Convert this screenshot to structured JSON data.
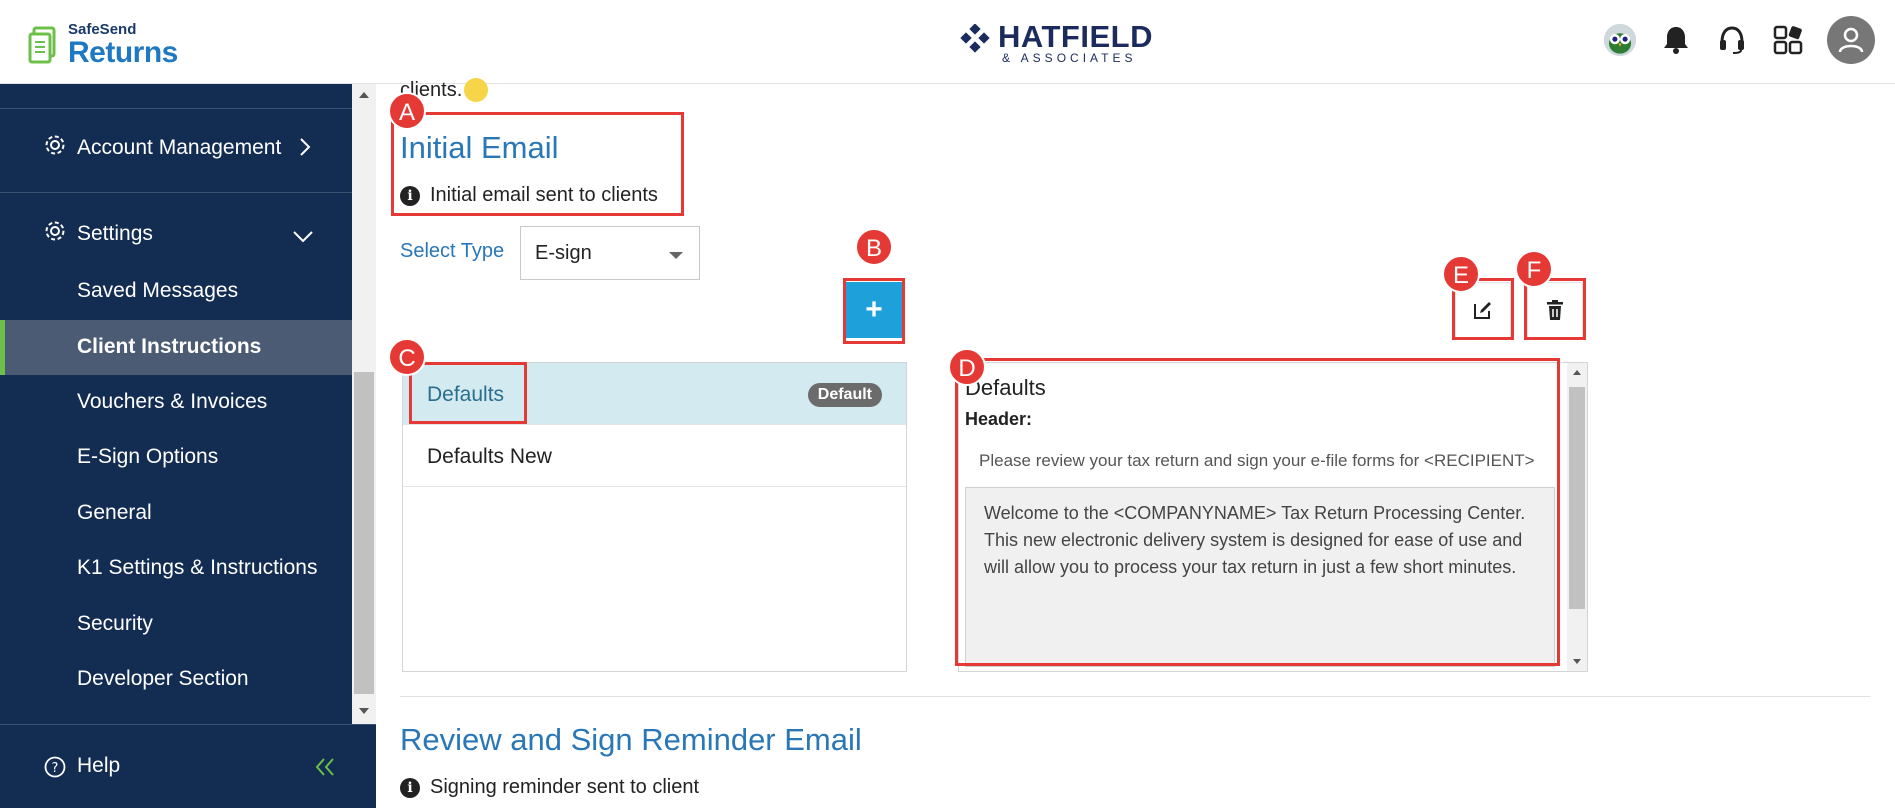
{
  "header": {
    "logo_small": "SafeSend",
    "logo_big": "Returns",
    "brand_name": "HATFIELD",
    "brand_sub": "& ASSOCIATES"
  },
  "sidebar": {
    "account_management": "Account Management",
    "settings": "Settings",
    "items": [
      {
        "label": "Saved Messages"
      },
      {
        "label": "Client Instructions"
      },
      {
        "label": "Vouchers & Invoices"
      },
      {
        "label": "E-Sign Options"
      },
      {
        "label": "General"
      },
      {
        "label": "K1 Settings & Instructions"
      },
      {
        "label": "Security"
      },
      {
        "label": "Developer Section"
      }
    ],
    "help": "Help"
  },
  "main": {
    "top_text": "clients.",
    "section_title": "Initial Email",
    "section_info": "Initial email sent to clients",
    "select_label": "Select Type",
    "select_value": "E-sign",
    "add_label": "+",
    "list": [
      {
        "label": "Defaults",
        "badge": "Default"
      },
      {
        "label": "Defaults New"
      }
    ],
    "preview": {
      "title": "Defaults",
      "header_label": "Header:",
      "subject": "Please review your tax return and sign your e-file forms for <RECIPIENT>",
      "body": "Welcome to the <COMPANYNAME> Tax Return Processing Center. This new electronic delivery system is designed for ease of use and will allow you to process your tax return in just a few short minutes."
    },
    "next_title": "Review and Sign Reminder Email",
    "next_info": "Signing reminder sent to client"
  },
  "annotations": {
    "a": "A",
    "b": "B",
    "c": "C",
    "d": "D",
    "e": "E",
    "f": "F"
  },
  "colors": {
    "sidebar_bg": "#132c52",
    "accent_blue": "#2a77b8",
    "add_button": "#1ea1db",
    "annotation_red": "#e53935",
    "active_bar": "#6cc04a"
  }
}
